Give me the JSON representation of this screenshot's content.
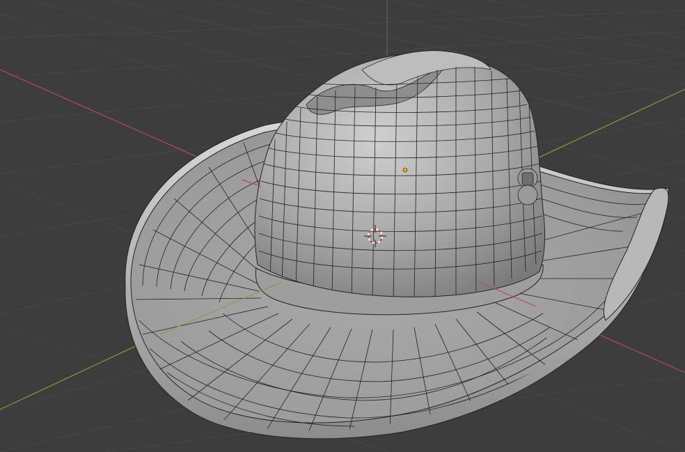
{
  "app": {
    "name": "",
    "view": "3D Viewport"
  },
  "colors": {
    "background": "#3d3d3d",
    "grid_minor": "#474747",
    "grid_major": "#4d4d4d",
    "axis_x": "#b84a55",
    "axis_y": "#76a33a",
    "axis_z": "#6b6b6b",
    "mesh_fill": "#9a9a9a",
    "mesh_highlight": "#c4c4c4",
    "mesh_shadow": "#6e6e6e",
    "wire": "#1a1a1a",
    "origin_dot": "#f0a020",
    "cursor_red": "#d04040",
    "cursor_white": "#ffffff"
  },
  "objects": {
    "mesh_name": "",
    "cursor": "3d-cursor-icon",
    "origin": "object-origin-dot"
  }
}
